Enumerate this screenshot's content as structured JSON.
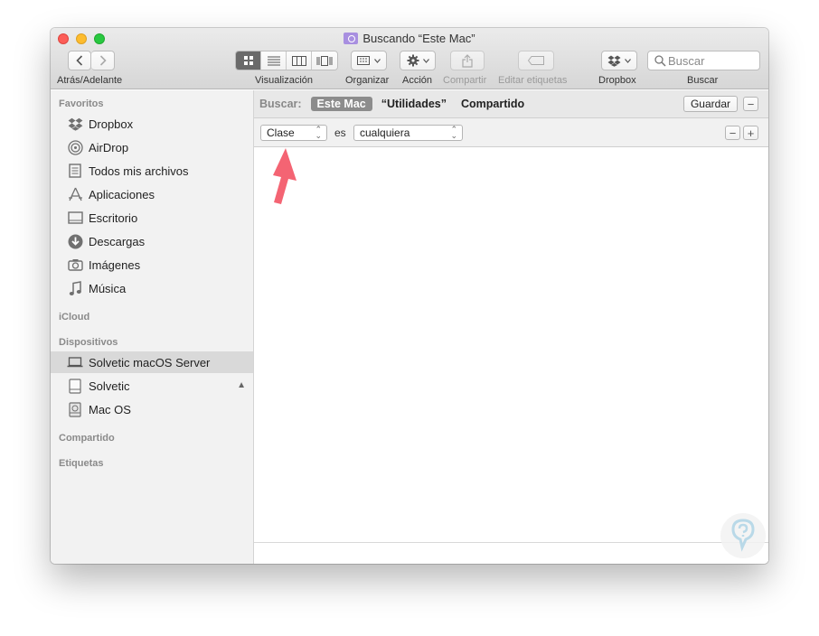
{
  "window": {
    "title": "Buscando “Este Mac”"
  },
  "toolbar": {
    "nav_label": "Atrás/Adelante",
    "view_label": "Visualización",
    "organize_label": "Organizar",
    "action_label": "Acción",
    "share_label": "Compartir",
    "tags_label": "Editar etiquetas",
    "dropbox_label": "Dropbox",
    "search_label": "Buscar",
    "search_placeholder": "Buscar",
    "active_view": "icon"
  },
  "sidebar": {
    "sections": {
      "favorites": "Favoritos",
      "icloud": "iCloud",
      "devices": "Dispositivos",
      "shared": "Compartido",
      "tags": "Etiquetas"
    },
    "favorites": [
      {
        "label": "Dropbox",
        "icon": "dropbox-icon"
      },
      {
        "label": "AirDrop",
        "icon": "airdrop-icon"
      },
      {
        "label": "Todos mis archivos",
        "icon": "all-files-icon"
      },
      {
        "label": "Aplicaciones",
        "icon": "applications-icon"
      },
      {
        "label": "Escritorio",
        "icon": "desktop-icon"
      },
      {
        "label": "Descargas",
        "icon": "downloads-icon"
      },
      {
        "label": "Imágenes",
        "icon": "camera-icon"
      },
      {
        "label": "Música",
        "icon": "music-note-icon"
      }
    ],
    "devices": [
      {
        "label": "Solvetic macOS Server",
        "icon": "laptop-icon",
        "selected": true
      },
      {
        "label": "Solvetic",
        "icon": "external-disk-icon",
        "ejectable": true
      },
      {
        "label": "Mac OS",
        "icon": "internal-disk-icon"
      }
    ]
  },
  "search": {
    "scope_label": "Buscar:",
    "scopes": [
      "Este Mac",
      "“Utilidades”",
      "Compartido"
    ],
    "active_scope": "Este Mac",
    "save_label": "Guardar",
    "criteria": {
      "attribute": "Clase",
      "operator": "es",
      "value": "cualquiera"
    }
  },
  "colors": {
    "annotation_arrow": "#f46473",
    "close": "#fc5d57",
    "minimize": "#fdbc2e",
    "maximize": "#28c840"
  }
}
